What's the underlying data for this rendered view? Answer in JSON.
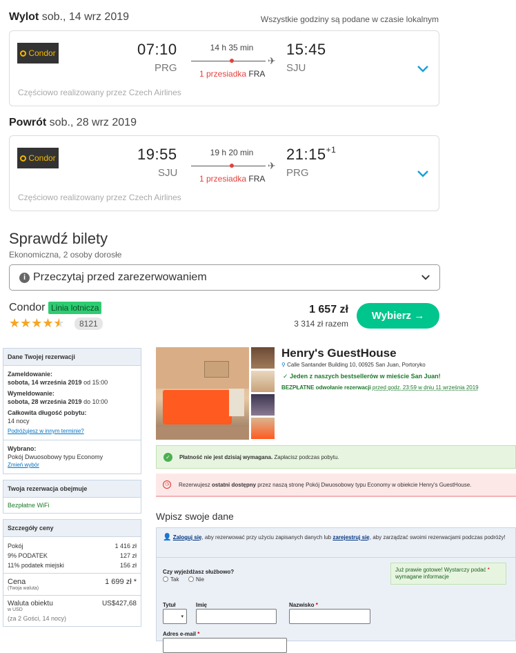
{
  "outbound": {
    "label": "Wylot",
    "date": "sob., 14 wrz 2019",
    "dep_time": "07:10",
    "dep_code": "PRG",
    "arr_time": "15:45",
    "arr_code": "SJU",
    "arr_day_offset": "",
    "duration": "14 h 35 min",
    "stops": "1 przesiadka",
    "stop_airport": "FRA",
    "operated_by": "Częściowo realizowany przez Czech Airlines",
    "airline_logo": "Condor"
  },
  "timezone_note": "Wszystkie godziny są podane w czasie lokalnym",
  "return": {
    "label": "Powrót",
    "date": "sob., 28 wrz 2019",
    "dep_time": "19:55",
    "dep_code": "SJU",
    "arr_time": "21:15",
    "arr_code": "PRG",
    "arr_day_offset": "+1",
    "duration": "19 h 20 min",
    "stops": "1 przesiadka",
    "stop_airport": "FRA",
    "operated_by": "Częściowo realizowany przez Czech Airlines",
    "airline_logo": "Condor"
  },
  "tickets": {
    "title": "Sprawdź bilety",
    "subtitle": "Ekonomiczna, 2 osoby dorosłe",
    "read_before": "Przeczytaj przed zarezerwowaniem",
    "airline": "Condor",
    "airline_badge": "Linia lotnicza",
    "stars": "★★★★★",
    "rating": 4.5,
    "reviews": "8121",
    "price": "1 657 zł",
    "price_total": "3 314 zł razem",
    "select_label": "Wybierz →"
  },
  "colors": {
    "accent_green": "#00c58c",
    "stop_red": "#e4423c",
    "chevron_blue": "#1a9fd9",
    "star_orange": "#f5a623"
  },
  "booking": {
    "sidebar": {
      "details_title": "Dane Twojej rezerwacji",
      "checkin_label": "Zameldowanie:",
      "checkin_date": "sobota, 14 września 2019",
      "checkin_time": "od 15:00",
      "checkout_label": "Wymeldowanie:",
      "checkout_date": "sobota, 28 września 2019",
      "checkout_time": "do 10:00",
      "stay_label": "Całkowita długość pobytu:",
      "stay_value": "14 nocy",
      "change_dates": "Podróżujesz w innym terminie?",
      "chosen_label": "Wybrano:",
      "chosen_room": "Pokój Dwuosobowy typu Economy",
      "change_choice": "Zmień wybór",
      "includes_title": "Twoja rezerwacja obejmuje",
      "includes_item": "Bezpłatne WiFi",
      "price_title": "Szczegóły ceny",
      "price_rows": [
        {
          "label": "Pokój",
          "value": "1 416 zł"
        },
        {
          "label": "9% PODATEK",
          "value": "127 zł"
        },
        {
          "label": "11% podatek miejski",
          "value": "156 zł"
        }
      ],
      "total_label": "Cena",
      "total_sub": "(Twoja waluta)",
      "total_value": "1 699 zł *",
      "local_label": "Waluta obiektu",
      "local_sub": "w USD",
      "local_value": "US$427,68",
      "guests_note": "(za 2 Gości, 14 nocy)"
    },
    "hotel": {
      "name": "Henry's GuestHouse",
      "address": "Calle Santander Building 10, 00925 San Juan, Portoryko",
      "bestseller": "Jeden z naszych bestsellerów w mieście San Juan!",
      "cancel_bold": "BEZPŁATNE odwołanie rezerwacji",
      "cancel_rest": "przed godz. 23:59 w dniu 11 września 2019"
    },
    "msg_payment_bold": "Płatność nie jest dzisiaj wymagana.",
    "msg_payment_rest": "Zapłacisz podczas pobytu.",
    "msg_last_pre": "Rezerwujesz",
    "msg_last_bold": "ostatni dostępny",
    "msg_last_rest": "przez naszą stronę Pokój Dwuosobowy typu Economy w obiekcie Henry's GuestHouse.",
    "form": {
      "title": "Wpisz swoje dane",
      "login_link": "Zaloguj się",
      "login_mid": ", aby rezerwować przy użyciu zapisanych danych lub",
      "register_link": "zarejestruj się",
      "login_end": ", aby zarządzać swoimi rezerwacjami podczas podróży!",
      "business_q": "Czy wyjeżdżasz służbowo?",
      "yes": "Tak",
      "no": "Nie",
      "hint": "Już prawie gotowe! Wystarczy podać",
      "hint2": "wymagane informacje",
      "title_label": "Tytuł",
      "first_label": "Imię",
      "last_label": "Nazwisko",
      "email_label": "Adres e-mail"
    }
  }
}
